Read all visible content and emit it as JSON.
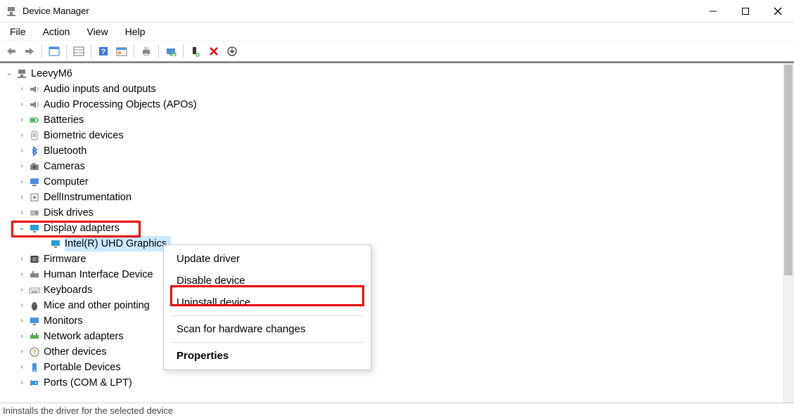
{
  "window": {
    "title": "Device Manager"
  },
  "menu": {
    "file": "File",
    "action": "Action",
    "view": "View",
    "help": "Help"
  },
  "tree": {
    "root": "LeevyM6",
    "items": [
      {
        "label": "Audio inputs and outputs",
        "icon": "speaker"
      },
      {
        "label": "Audio Processing Objects (APOs)",
        "icon": "speaker"
      },
      {
        "label": "Batteries",
        "icon": "battery"
      },
      {
        "label": "Biometric devices",
        "icon": "biometric"
      },
      {
        "label": "Bluetooth",
        "icon": "bluetooth"
      },
      {
        "label": "Cameras",
        "icon": "camera"
      },
      {
        "label": "Computer",
        "icon": "computer"
      },
      {
        "label": "DellInstrumentation",
        "icon": "device"
      },
      {
        "label": "Disk drives",
        "icon": "disk"
      },
      {
        "label": "Display adapters",
        "icon": "display",
        "expanded": true,
        "highlighted": true,
        "children": [
          {
            "label": "Intel(R) UHD Graphics",
            "icon": "display",
            "selected": true
          }
        ]
      },
      {
        "label": "Firmware",
        "icon": "firmware"
      },
      {
        "label": "Human Interface Device",
        "icon": "hid"
      },
      {
        "label": "Keyboards",
        "icon": "keyboard"
      },
      {
        "label": "Mice and other pointing",
        "icon": "mouse"
      },
      {
        "label": "Monitors",
        "icon": "monitor"
      },
      {
        "label": "Network adapters",
        "icon": "network"
      },
      {
        "label": "Other devices",
        "icon": "other"
      },
      {
        "label": "Portable Devices",
        "icon": "portable"
      },
      {
        "label": "Ports (COM & LPT)",
        "icon": "port"
      }
    ]
  },
  "contextMenu": {
    "update": "Update driver",
    "disable": "Disable device",
    "uninstall": "Uninstall device",
    "scan": "Scan for hardware changes",
    "properties": "Properties"
  },
  "statusbar": "Ininstalls the driver for the selected device"
}
